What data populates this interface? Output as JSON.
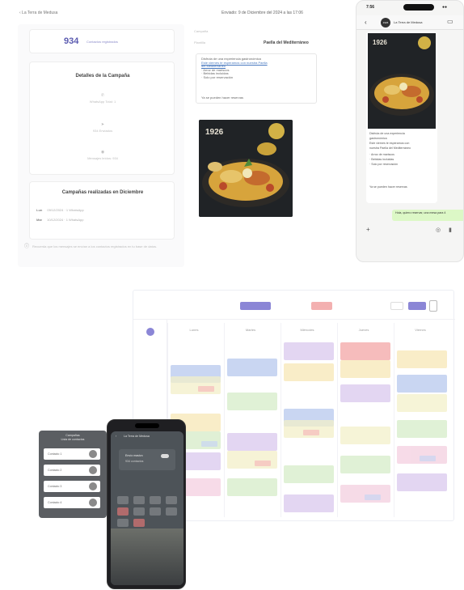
{
  "campaign_panel": {
    "back_link": "‹ La Terra de Medusa",
    "date_range": "Enviado: 9 de Diciembre del 2024 a las 17:06",
    "count": "934",
    "count_label": "Contactos registrados",
    "details_title": "Detalles de la Campaña",
    "stats": [
      {
        "icon": "phone-icon",
        "text": "WhatsApp Total: 1"
      },
      {
        "icon": "send-icon",
        "text": "934 Enviados"
      },
      {
        "icon": "eye-icon",
        "text": "Mensajes leídos: 934"
      }
    ],
    "done_title": "Campañas realizadas en Diciembre",
    "done_rows": [
      {
        "tag": "Lun",
        "text": "09/12/2024 · 1 WhatsApp"
      },
      {
        "tag": "Mar",
        "text": "10/12/2024 · 1 WhatsApp"
      }
    ],
    "note": "Recuerda que los mensajes se envían a los contactos registrados en tu base de datos."
  },
  "message_panel": {
    "label_campaign": "Campaña",
    "label_template": "Plantilla",
    "template_name": "Paella del Mediterráneo",
    "lines": [
      "Disfruta de una experiencia gastronómica",
      "Este viernes te esperamos con nuestra Paella",
      "del Mediterráneo",
      "· Arroz de mariscos",
      "· Bebidas incluidas",
      "· Solo por reservación"
    ],
    "action": "Ya se pueden hacer reservas"
  },
  "chat_phone": {
    "time": "7:56",
    "battery": "●●",
    "contact_name": "La Terra de Medusa",
    "avatar_text": "1926",
    "image_badge": "1926",
    "bubble_lines": [
      "Disfruta de una experiencia",
      "gastronómica",
      "Este viernes te esperamos con",
      "nuestra Paella del Mediterráneo",
      "· Arroz de mariscos",
      "· Bebidas incluidas",
      "· Solo por reservación",
      "Ya se pueden hacer reservas"
    ],
    "reply": "Hola, quiero reservar, una mesa para 4"
  },
  "calendar": {
    "days": [
      "Lunes",
      "Martes",
      "Miércoles",
      "Jueves",
      "Viernes"
    ]
  },
  "mini_phone_a": {
    "header_line1": "Campañas",
    "header_line2": "Lista de contactos",
    "rows": [
      "Contacto 1",
      "Contacto 2",
      "Contacto 3",
      "Contacto 4"
    ]
  },
  "mini_phone_b": {
    "header": "La Terra de Medusa",
    "card_title": "Envío masivo",
    "card_subtitle": "934 contactos"
  },
  "colors": {
    "accent": "#5b5bb0",
    "calendar_purple": "#8b86d6",
    "calendar_red": "#e45a5a",
    "whatsapp_bubble": "#dcf8c6"
  }
}
